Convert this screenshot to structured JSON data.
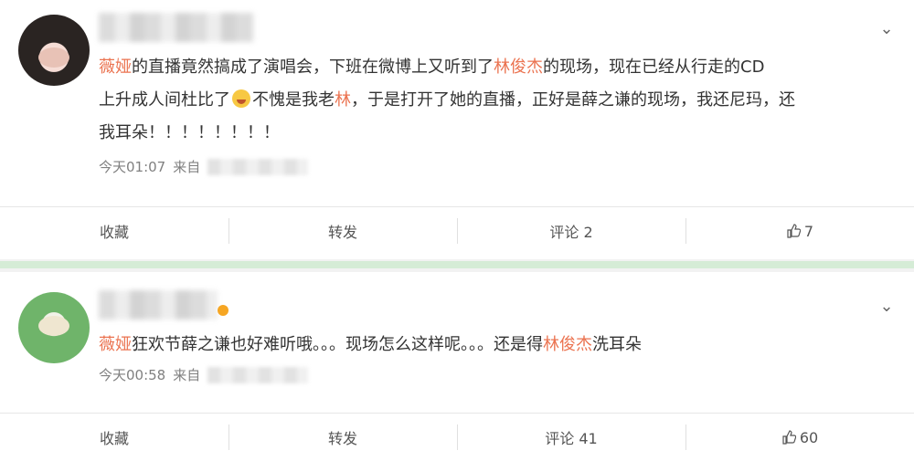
{
  "posts": [
    {
      "mention1": "薇娅",
      "text1": "的直播竟然搞成了演唱会，下班在微博上又听到了",
      "mention2": "林俊杰",
      "text2": "的现场，现在已经从行走的CD",
      "line2a": "上升成人间杜比了",
      "line2b": "不愧是我老",
      "mention3": "林",
      "line2c": "，于是打开了她的直播，正好是薛之谦的现场，我还尼玛，还",
      "line3": "我耳朵！！！！！！！！",
      "time": "今天01:07",
      "from": "来自",
      "actions": {
        "collect": "收藏",
        "repost": "转发",
        "comment": "评论 2",
        "like": "7"
      }
    },
    {
      "mention1": "薇娅",
      "text1": "狂欢节薛之谦也好难听哦。。。现场怎么这样呢。。。还是得",
      "mention2": "林俊杰",
      "text2": "洗耳朵",
      "time": "今天00:58",
      "from": "来自",
      "actions": {
        "collect": "收藏",
        "repost": "转发",
        "comment": "评论 41",
        "like": "60"
      }
    }
  ],
  "icons": {
    "chevron": "chevron-down-icon",
    "like": "thumbs-up-icon"
  },
  "colors": {
    "mention": "#eb7350",
    "separator": "#d5ecd6"
  }
}
